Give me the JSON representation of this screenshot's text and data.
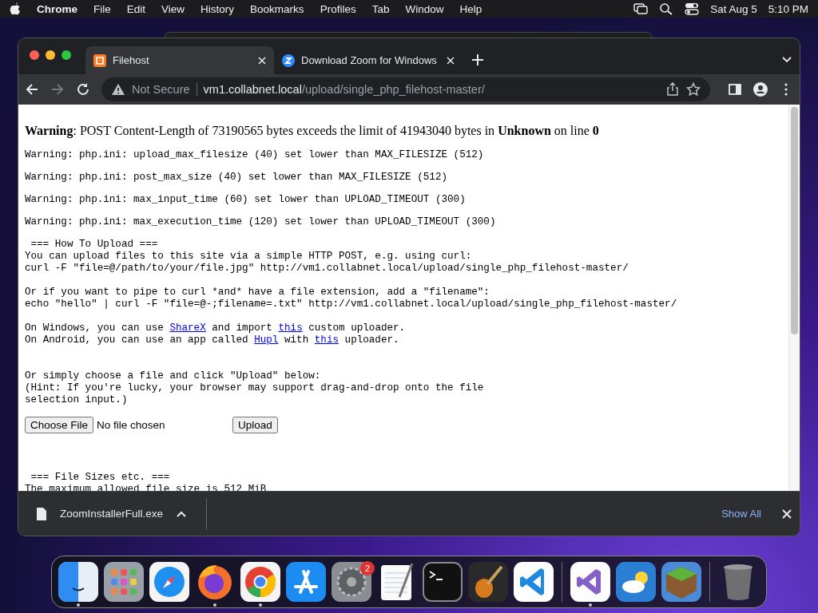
{
  "menu_bar": {
    "app": "Chrome",
    "items": [
      "File",
      "Edit",
      "View",
      "History",
      "Bookmarks",
      "Profiles",
      "Tab",
      "Window",
      "Help"
    ],
    "date": "Sat Aug 5",
    "time": "5:10 PM"
  },
  "tabs": [
    {
      "title": "Filehost",
      "selected": true,
      "kind": "filehost"
    },
    {
      "title": "Download Zoom for Windows",
      "selected": false,
      "kind": "zoom"
    }
  ],
  "address_bar": {
    "security": "Not Secure",
    "host": "vm1.collabnet.local",
    "path": "/upload/single_php_filehost-master/"
  },
  "page": {
    "error": "**Warning**: POST Content-Length of 73190565 bytes exceeds the limit of 41943040 bytes in **Unknown** on line **0**",
    "warnings": [
      "Warning: php.ini: upload_max_filesize (40) set lower than MAX_FILESIZE (512)",
      "Warning: php.ini: post_max_size (40) set lower than MAX_FILESIZE (512)",
      "Warning: php.ini: max_input_time (60) set lower than UPLOAD_TIMEOUT (300)",
      "Warning: php.ini: max_execution_time (120) set lower than UPLOAD_TIMEOUT (300)"
    ],
    "how_to_heading": " === How To Upload ===",
    "paragraphs": [
      {
        "extra_space": false,
        "lines": [
          [
            {
              "text": "You can upload files to this site via a simple HTTP POST, e.g. using curl:",
              "link": false
            }
          ],
          [
            {
              "text": "curl -F \"file=@/path/to/your/file.jpg\" http://vm1.collabnet.local/upload/single_php_filehost-master/",
              "link": false
            }
          ]
        ]
      },
      {
        "extra_space": false,
        "lines": [
          [
            {
              "text": "Or if you want to pipe to curl *and* have a file extension, add a \"filename\":",
              "link": false
            }
          ],
          [
            {
              "text": "echo \"hello\" | curl -F \"file=@-;filename=.txt\" http://vm1.collabnet.local/upload/single_php_filehost-master/",
              "link": false
            }
          ]
        ]
      },
      {
        "extra_space": false,
        "lines": [
          [
            {
              "text": "On Windows, you can use ",
              "link": false
            },
            {
              "text": "ShareX",
              "link": true
            },
            {
              "text": " and import ",
              "link": false
            },
            {
              "text": "this",
              "link": true
            },
            {
              "text": " custom uploader.",
              "link": false
            }
          ],
          [
            {
              "text": "On Android, you can use an app called ",
              "link": false
            },
            {
              "text": "Hupl",
              "link": true
            },
            {
              "text": " with ",
              "link": false
            },
            {
              "text": "this",
              "link": true
            },
            {
              "text": " uploader.",
              "link": false
            }
          ]
        ]
      },
      {
        "extra_space": true,
        "lines": [
          [
            {
              "text": "Or simply choose a file and click \"Upload\" below:",
              "link": false
            }
          ],
          [
            {
              "text": "(Hint: If you're lucky, your browser may support drag-and-drop onto the file",
              "link": false
            }
          ],
          [
            {
              "text": "selection input.)",
              "link": false
            }
          ]
        ]
      }
    ],
    "file_input": {
      "button": "Choose File",
      "value": "No file chosen"
    },
    "upload_button": "Upload",
    "sizes_heading": " === File Sizes etc. ===",
    "sizes_line": "The maximum allowed file size is 512 MiB"
  },
  "download_bar": {
    "file": "ZoomInstallerFull.exe",
    "show_all": "Show All"
  },
  "dock": {
    "groups": [
      [
        {
          "kind": "finder",
          "running": true
        },
        {
          "kind": "launchpad",
          "running": false
        },
        {
          "kind": "safari",
          "running": false
        },
        {
          "kind": "firefox",
          "running": true
        },
        {
          "kind": "chrome",
          "running": true
        },
        {
          "kind": "appstore",
          "running": false
        },
        {
          "kind": "settings",
          "running": false,
          "badge": "2"
        },
        {
          "kind": "textedit",
          "running": false
        },
        {
          "kind": "terminal",
          "running": false
        },
        {
          "kind": "guitar",
          "running": false
        },
        {
          "kind": "vscode",
          "running": false
        }
      ],
      [
        {
          "kind": "vstudio",
          "running": true
        },
        {
          "kind": "weather",
          "running": false
        },
        {
          "kind": "grassblock",
          "running": false
        }
      ],
      [
        {
          "kind": "trash",
          "running": false
        }
      ]
    ]
  }
}
